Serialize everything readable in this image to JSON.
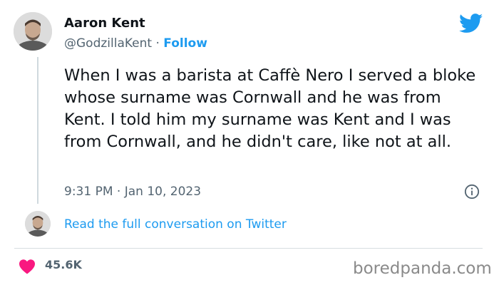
{
  "author": {
    "name": "Aaron Kent",
    "handle": "@GodzillaKent",
    "separator": " · ",
    "follow_label": "Follow"
  },
  "tweet": {
    "text": "When I was a barista at Caffè Nero I served a bloke whose surname was Cornwall and he was from Kent. I told him my surname was Kent and I was from Cornwall, and he didn't care, like not at all.",
    "time": "9:31 PM",
    "date_separator": " · ",
    "date": "Jan 10, 2023"
  },
  "conversation": {
    "read_full_label": "Read the full conversation on Twitter"
  },
  "engagement": {
    "likes": "45.6K"
  },
  "watermark": "boredpanda.com",
  "icons": [
    "twitter-bird-icon",
    "info-icon",
    "heart-icon"
  ],
  "colors": {
    "accent": "#1d9bf0",
    "heart": "#f91880",
    "text_primary": "#0f1419",
    "text_secondary": "#536471",
    "divider": "#d7dde1"
  }
}
